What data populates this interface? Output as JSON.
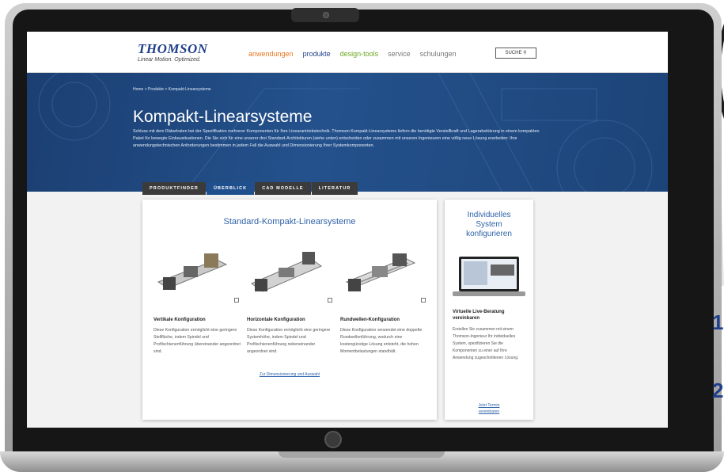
{
  "header": {
    "logo_main": "THOMSON",
    "logo_sub": "Linear Motion. Optimized.",
    "nav": [
      {
        "label": "anwendungen",
        "color": "#e87722"
      },
      {
        "label": "produkte",
        "color": "#1f3f8a"
      },
      {
        "label": "design-tools",
        "color": "#6aa820"
      },
      {
        "label": "service",
        "color": "#777777"
      },
      {
        "label": "schulungen",
        "color": "#777777"
      }
    ],
    "search_label": "SUCHE"
  },
  "hero": {
    "breadcrumb": "Home > Produkte > Kompakt-Linearsysteme",
    "title": "Kompakt-Linearsysteme",
    "description": "Schluss mit dem Rätselraten bei der Spezifikation mehrerer Komponenten für Ihre Linearantriebstechnik. Thomson Kompakt-Linearsysteme liefern die benötigte Verstellkraft und Lagerabstützung in einem kompakten Paket für bewegte Einbausituationen. Die Sie sich für eine unserer drei Standard-Architekturen (siehe unten) entscheiden oder zusammen mit unseren Ingenieuren eine völlig neue Lösung erarbeiten: Ihre anwendungstechnischen Anforderungen bestimmen in jedem Fall die Auswahl und Dimensionierung Ihrer Systemkomponenten."
  },
  "tabs": [
    {
      "label": "PRODUKTFINDER",
      "active": false
    },
    {
      "label": "ÜBERBLICK",
      "active": true
    },
    {
      "label": "CAD MODELLE",
      "active": false
    },
    {
      "label": "LITERATUR",
      "active": false
    }
  ],
  "main_card": {
    "title": "Standard-Kompakt-Linearsysteme",
    "products": [
      {
        "title": "Vertikale Konfiguration",
        "text": "Diese Konfiguration ermöglicht eine geringere Stellfläche, indem Spindel und Profilschienenführung übereinander angeordnet sind."
      },
      {
        "title": "Horizontale Konfiguration",
        "text": "Diese Konfiguration ermöglicht eine geringere Systemhöhe, indem Spindel und Profilschienenführung nebeneinander angeordnet sind."
      },
      {
        "title": "Rundwellen-Konfiguration",
        "text": "Diese Konfiguration verwendet eine doppelte Rundwellenführung, wodurch eine kostengünstige Lösung entsteht, die hohen Momentbelastungen standhält."
      }
    ],
    "link": "Zur Dimensionierung und Auswahl"
  },
  "side_card": {
    "title_lines": [
      "Individuelles",
      "System",
      "konfigurieren"
    ],
    "sub_lines": [
      "Virtuelle Live-Beratung",
      "vereinbaren"
    ],
    "text": "Erstellen Sie zusammen mit einem Thomson-Ingenieur Ihr individuelles System, spezifizieren Sie die Komponenten zu einer auf Ihre Anwendung zugeschnittenen Lösung.",
    "link_lines": [
      "Jetzt Termin",
      "vereinbaren"
    ]
  },
  "overlay": {
    "numbers": [
      "1",
      "2"
    ]
  }
}
